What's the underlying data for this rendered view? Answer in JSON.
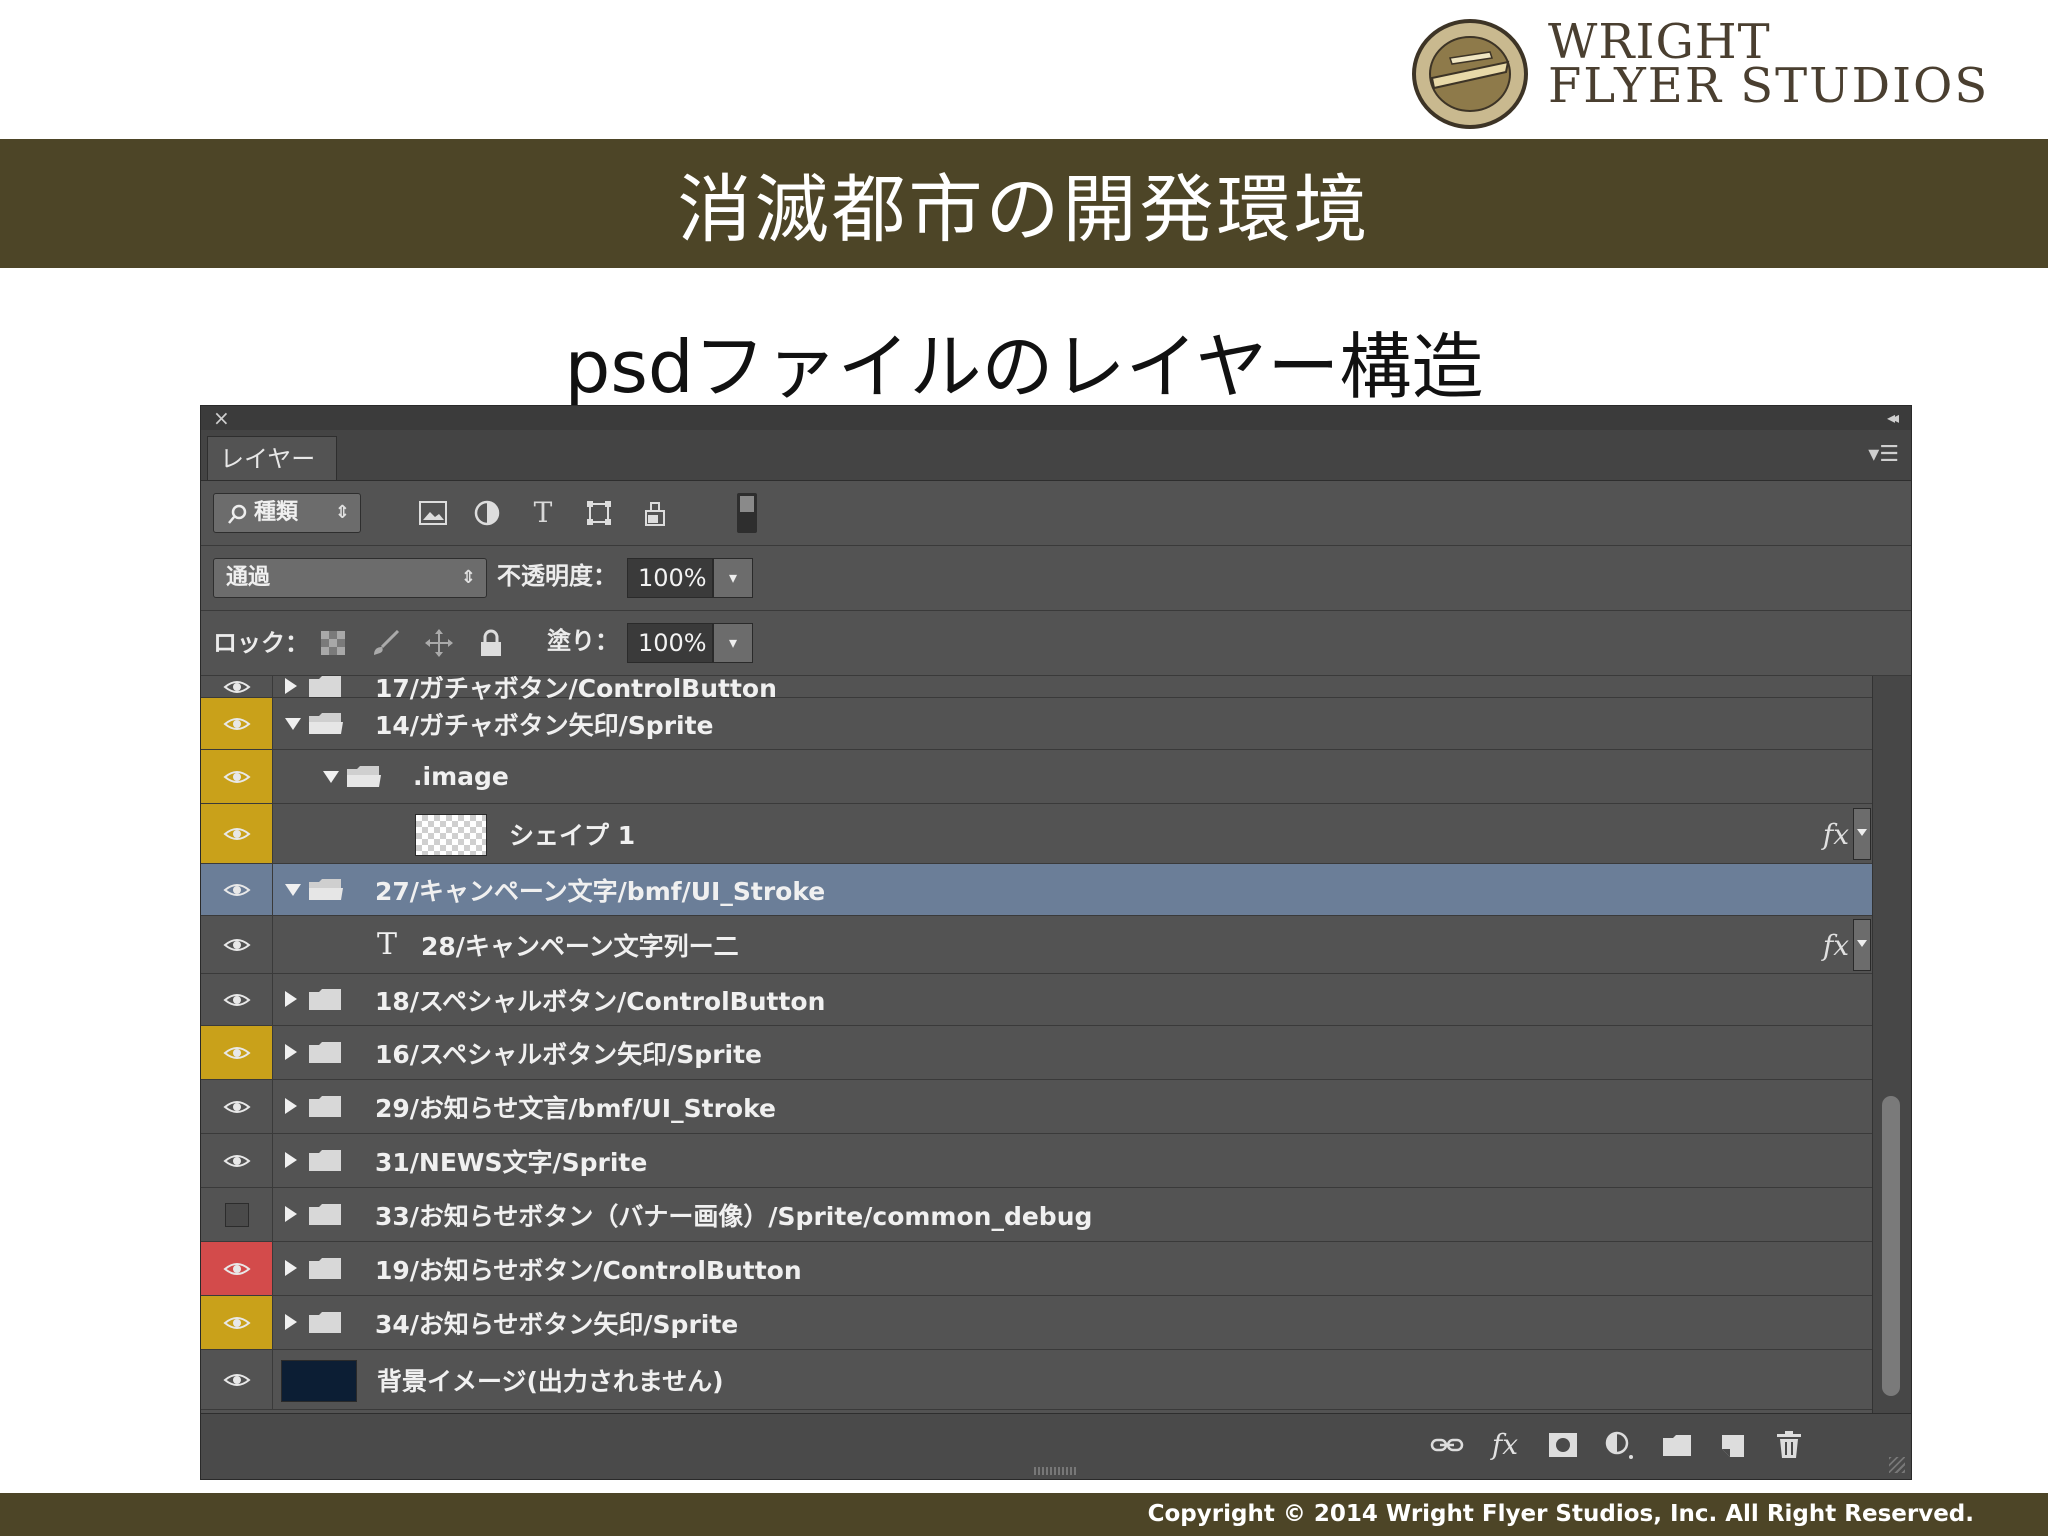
{
  "logo": {
    "line1": "WRIGHT",
    "line2": "FLYER STUDIOS"
  },
  "title": "消滅都市の開発環境",
  "subtitle": "psdファイルのレイヤー構造",
  "footer": "Copyright © 2014 Wright Flyer Studios, Inc. All Right Reserved.",
  "panel": {
    "close": "×",
    "collapse": "◂◂",
    "tab": "レイヤー",
    "menu": "▾☰",
    "filter": {
      "label": "種類",
      "icon": "search-icon"
    },
    "filter_icons": [
      "image-filter-icon",
      "adjustment-filter-icon",
      "type-filter-icon",
      "shape-filter-icon",
      "smart-object-filter-icon",
      "filter-toggle-icon"
    ],
    "blend_mode": "通過",
    "opacity_label": "不透明度：",
    "opacity_value": "100%",
    "lock_label": "ロック：",
    "lock_icons": [
      "lock-transparent-icon",
      "lock-paint-icon",
      "lock-position-icon",
      "lock-all-icon"
    ],
    "fill_label": "塗り：",
    "fill_value": "100%",
    "layers": [
      {
        "name": "17/ガチャボタン/ControlButton",
        "type": "group",
        "expanded": false,
        "eye": "normal",
        "indent": 0,
        "selected": false,
        "fx": false
      },
      {
        "name": "14/ガチャボタン矢印/Sprite",
        "type": "group",
        "expanded": true,
        "eye": "yellow",
        "indent": 0,
        "selected": false,
        "fx": false
      },
      {
        "name": ".image",
        "type": "group",
        "expanded": true,
        "eye": "yellow",
        "indent": 1,
        "selected": false,
        "fx": false
      },
      {
        "name": "シェイプ 1",
        "type": "shape",
        "eye": "yellow",
        "indent": 2,
        "selected": false,
        "fx": true
      },
      {
        "name": "27/キャンペーン文字/bmf/UI_Stroke",
        "type": "group",
        "expanded": true,
        "eye": "normal",
        "indent": 0,
        "selected": true,
        "fx": false
      },
      {
        "name": "28/キャンペーン文字列ー二",
        "type": "text",
        "eye": "normal",
        "indent": 1,
        "selected": false,
        "fx": true
      },
      {
        "name": "18/スペシャルボタン/ControlButton",
        "type": "group",
        "expanded": false,
        "eye": "normal",
        "indent": 0,
        "selected": false,
        "fx": false
      },
      {
        "name": "16/スペシャルボタン矢印/Sprite",
        "type": "group",
        "expanded": false,
        "eye": "yellow",
        "indent": 0,
        "selected": false,
        "fx": false
      },
      {
        "name": "29/お知らせ文言/bmf/UI_Stroke",
        "type": "group",
        "expanded": false,
        "eye": "normal",
        "indent": 0,
        "selected": false,
        "fx": false
      },
      {
        "name": "31/NEWS文字/Sprite",
        "type": "group",
        "expanded": false,
        "eye": "normal",
        "indent": 0,
        "selected": false,
        "fx": false
      },
      {
        "name": "33/お知らせボタン（バナー画像）/Sprite/common_debug",
        "type": "group",
        "expanded": false,
        "eye": "hidden",
        "indent": 0,
        "selected": false,
        "fx": false
      },
      {
        "name": "19/お知らせボタン/ControlButton",
        "type": "group",
        "expanded": false,
        "eye": "red",
        "indent": 0,
        "selected": false,
        "fx": false
      },
      {
        "name": "34/お知らせボタン矢印/Sprite",
        "type": "group",
        "expanded": false,
        "eye": "yellow",
        "indent": 0,
        "selected": false,
        "fx": false
      },
      {
        "name": "背景イメージ(出力されません)",
        "type": "image",
        "eye": "normal",
        "indent": 0,
        "selected": false,
        "fx": false
      }
    ],
    "fx_label": "fx",
    "bottom_icons": [
      "link-icon",
      "fx-icon",
      "mask-icon",
      "adjustment-icon",
      "new-group-icon",
      "new-layer-icon",
      "trash-icon"
    ]
  }
}
